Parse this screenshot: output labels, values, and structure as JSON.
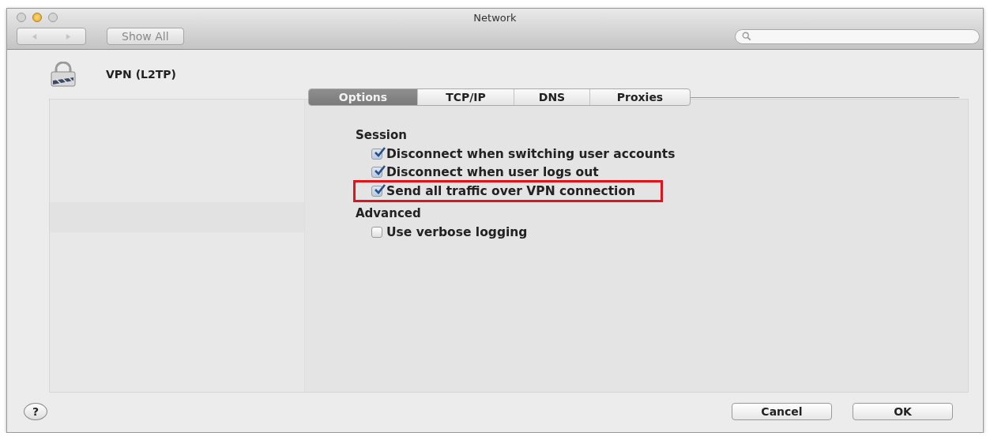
{
  "window": {
    "title": "Network",
    "show_all": "Show All"
  },
  "header": {
    "service": "VPN (L2TP)"
  },
  "tabs": [
    {
      "label": "Options",
      "selected": true
    },
    {
      "label": "TCP/IP",
      "selected": false
    },
    {
      "label": "DNS",
      "selected": false
    },
    {
      "label": "Proxies",
      "selected": false
    }
  ],
  "sections": [
    {
      "title": "Session",
      "options": [
        {
          "label": "Disconnect when switching user accounts",
          "checked": true,
          "highlighted": false
        },
        {
          "label": "Disconnect when user logs out",
          "checked": true,
          "highlighted": false
        },
        {
          "label": "Send all traffic over VPN connection",
          "checked": true,
          "highlighted": true
        }
      ]
    },
    {
      "title": "Advanced",
      "options": [
        {
          "label": "Use verbose logging",
          "checked": false,
          "highlighted": false
        }
      ]
    }
  ],
  "help_button": "?",
  "buttons": [
    "Cancel",
    "OK"
  ]
}
